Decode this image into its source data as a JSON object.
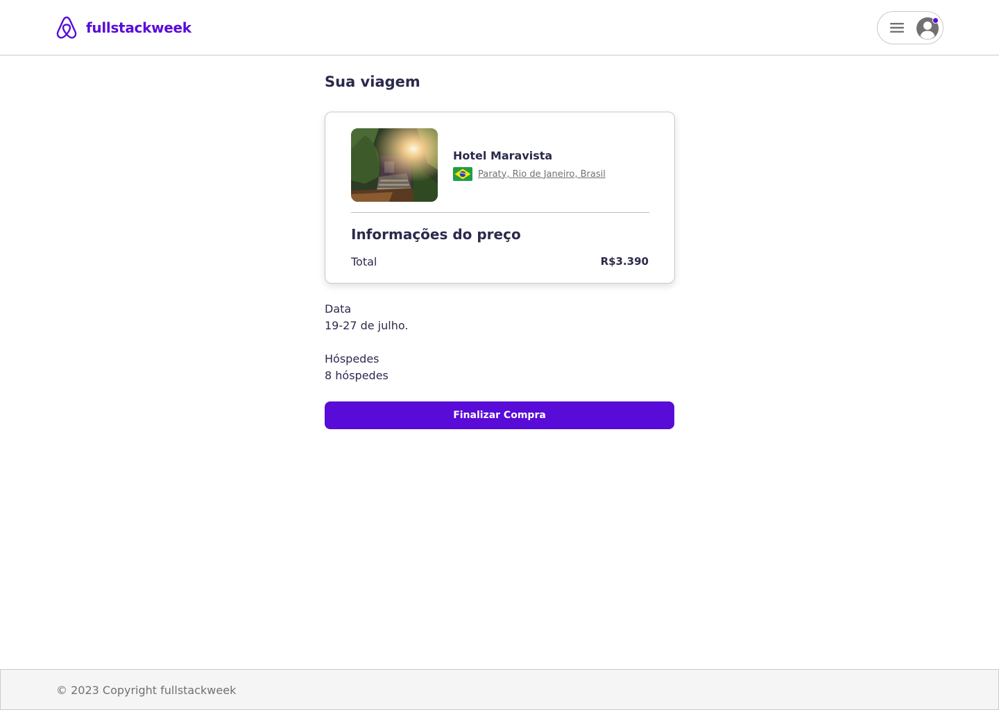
{
  "header": {
    "brand": "fullstackweek",
    "brand_color": "#590bd8",
    "menu_icon": "hamburger-menu-icon",
    "avatar_icon": "user-avatar-icon"
  },
  "trip": {
    "title": "Sua viagem",
    "hotel": {
      "name": "Hotel Maravista",
      "location": "Paraty, Rio de Janeiro, Brasil",
      "flag_icon": "brazil-flag-icon"
    },
    "price": {
      "title": "Informações do preço",
      "total_label": "Total",
      "total_value": "R$3.390"
    },
    "date": {
      "label": "Data",
      "value": "19-27 de julho."
    },
    "guests": {
      "label": "Hóspedes",
      "value": "8 hóspedes"
    },
    "button_label": "Finalizar Compra"
  },
  "footer": {
    "copyright": "© 2023 Copyright fullstackweek"
  }
}
